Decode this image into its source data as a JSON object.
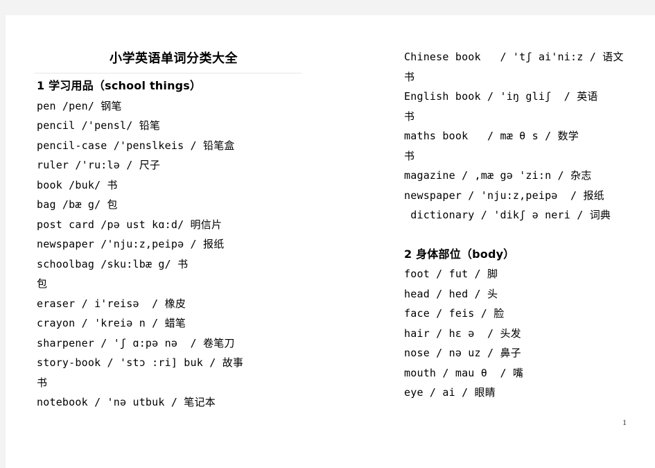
{
  "document": {
    "title": "小学英语单词分类大全",
    "page_number": "1"
  },
  "left_column": [
    {
      "type": "heading",
      "text": "1 学习用品（school things）"
    },
    {
      "type": "entry",
      "text": "pen /pen/ 钢笔"
    },
    {
      "type": "entry",
      "text": "pencil /'pensl/ 铅笔"
    },
    {
      "type": "entry",
      "text": "pencil-case /'penslkeis / 铅笔盒"
    },
    {
      "type": "entry",
      "text": "ruler /'ru:lə / 尺子"
    },
    {
      "type": "entry",
      "text": "book /buk/ 书"
    },
    {
      "type": "entry",
      "text": "bag /bæ g/ 包"
    },
    {
      "type": "entry",
      "text": "post card /pə ust kɑ:d/ 明信片"
    },
    {
      "type": "entry",
      "text": "newspaper /'nju:z,peipə / 报纸"
    },
    {
      "type": "entry",
      "text": "schoolbag /sku:lbæ g/ 书"
    },
    {
      "type": "entry",
      "text": "包"
    },
    {
      "type": "entry",
      "text": "eraser / i'reisə  / 橡皮"
    },
    {
      "type": "entry",
      "text": "crayon / 'kreiə n / 蜡笔"
    },
    {
      "type": "entry",
      "text": "sharpener / 'ʃ ɑ:pə nə  / 卷笔刀"
    },
    {
      "type": "entry",
      "text": "story-book / 'stɔ :ri] buk / 故事"
    },
    {
      "type": "entry",
      "text": "书"
    },
    {
      "type": "entry",
      "text": "notebook / 'nə utbuk / 笔记本"
    }
  ],
  "right_column": [
    {
      "type": "entry",
      "text": "Chinese book   / 'tʃ ai'ni:z / 语文"
    },
    {
      "type": "entry",
      "text": "书"
    },
    {
      "type": "entry",
      "text": "English book / 'iŋ gliʃ  / 英语"
    },
    {
      "type": "entry",
      "text": "书"
    },
    {
      "type": "entry",
      "text": "maths book   / mæ θ s / 数学"
    },
    {
      "type": "entry",
      "text": "书"
    },
    {
      "type": "entry",
      "text": "magazine / ,mæ gə 'zi:n / 杂志"
    },
    {
      "type": "entry",
      "text": "newspaper / 'nju:z,peipə  / 报纸"
    },
    {
      "type": "entry",
      "text": " dictionary / 'dikʃ ə neri / 词典"
    },
    {
      "type": "blank",
      "text": ""
    },
    {
      "type": "heading",
      "text": "2 身体部位（body）"
    },
    {
      "type": "entry",
      "text": "foot / fut / 脚"
    },
    {
      "type": "entry",
      "text": "head / hed / 头"
    },
    {
      "type": "entry",
      "text": "face / feis / 脸"
    },
    {
      "type": "entry",
      "text": "hair / hɛ ə  / 头发"
    },
    {
      "type": "entry",
      "text": "nose / nə uz / 鼻子"
    },
    {
      "type": "entry",
      "text": "mouth / mau θ  / 嘴"
    },
    {
      "type": "entry",
      "text": "eye / ai / 眼睛"
    }
  ]
}
